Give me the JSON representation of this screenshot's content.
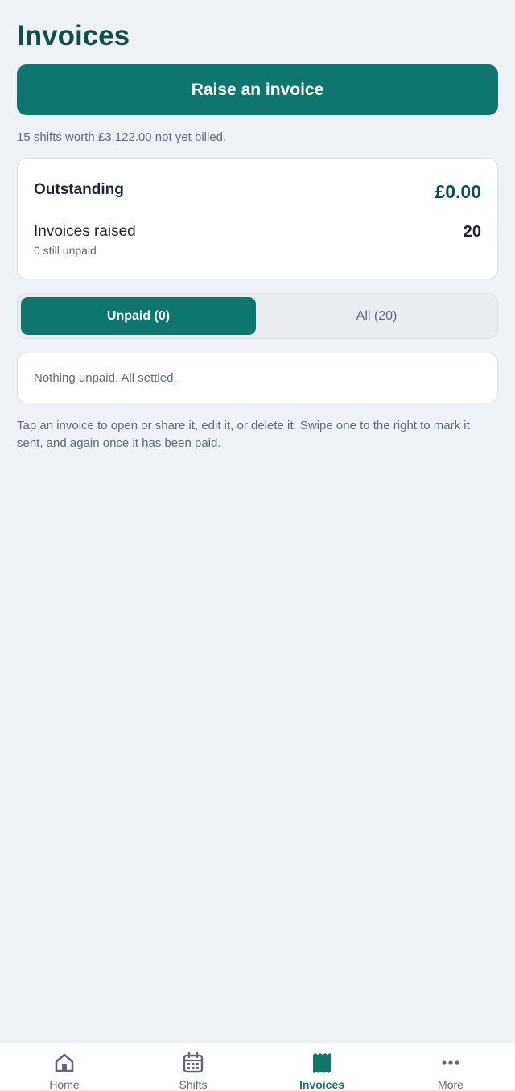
{
  "page": {
    "title": "Invoices"
  },
  "actions": {
    "raise_label": "Raise an invoice"
  },
  "unbilled_note": "15 shifts worth £3,122.00 not yet billed.",
  "summary": {
    "outstanding_label": "Outstanding",
    "outstanding_value": "£0.00",
    "raised_label": "Invoices raised",
    "raised_value": "20",
    "still_unpaid": "0 still unpaid"
  },
  "filter": {
    "unpaid_label": "Unpaid (0)",
    "all_label": "All (20)",
    "selected": "Unpaid (0)"
  },
  "empty_state": "Nothing unpaid. All settled.",
  "help_text": "Tap an invoice to open or share it, edit it, or delete it. Swipe one to the right to mark it sent, and again once it has been paid.",
  "nav": {
    "items": [
      {
        "label": "Home",
        "icon": "home-icon"
      },
      {
        "label": "Shifts",
        "icon": "calendar-icon"
      },
      {
        "label": "Invoices",
        "icon": "receipt-icon"
      },
      {
        "label": "More",
        "icon": "more-dots-icon"
      }
    ],
    "active": "Invoices"
  },
  "colors": {
    "accent": "#0f766e",
    "title": "#0f4f49",
    "background": "#eef1f5",
    "muted_text": "#5f6b7a",
    "inactive_icon": "#5d6978"
  }
}
